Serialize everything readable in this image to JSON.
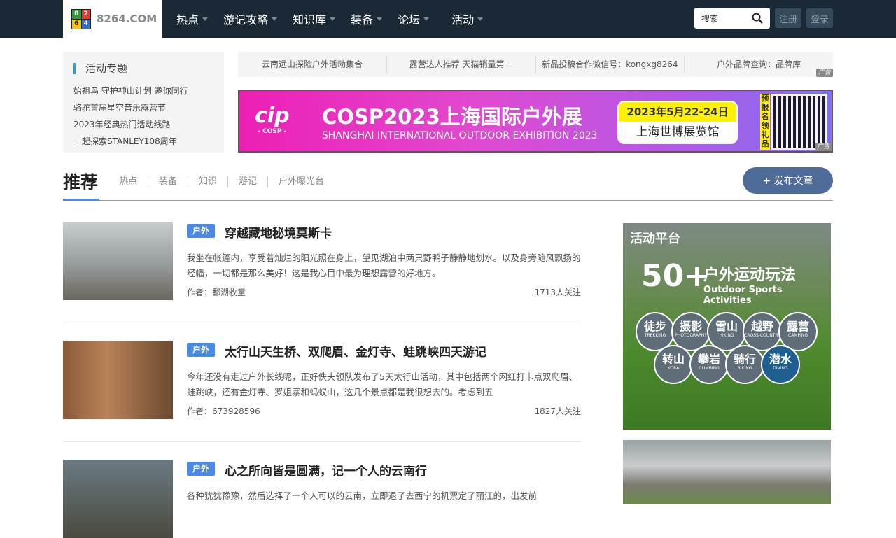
{
  "header": {
    "logo_text": "8264.COM",
    "logo_digits": [
      "8",
      "2",
      "6",
      "4"
    ],
    "nav": [
      "热点",
      "游记攻略",
      "知识库",
      "装备",
      "论坛",
      "活动"
    ],
    "search_placeholder": "搜索",
    "register": "注册",
    "login": "登录"
  },
  "topics": {
    "title": "活动专题",
    "items": [
      "始祖鸟 守护神山计划 邀你同行",
      "骆驼首届星空音乐露营节",
      "2023年经典热门活动线路",
      "一起探索STANLEY108周年"
    ]
  },
  "ad_links": [
    "云南远山探险户外活动集合",
    "露营达人推荐 天猫销量第一",
    "新品投稿合作微信号：kongxg8264",
    "户外品牌查询：品牌库"
  ],
  "ad_label": "广告",
  "banner": {
    "logo": "cip",
    "logo_sub": "- COSP -",
    "title": "COSP2023上海国际户外展",
    "subtitle": "SHANGHAI INTERNATIONAL OUTDOOR EXHIBITION 2023",
    "date": "2023年5月22-24日",
    "venue": "上海世博展览馆",
    "side": "预报名领礼品"
  },
  "feed": {
    "title": "推荐",
    "tabs": [
      "热点",
      "装备",
      "知识",
      "游记",
      "户外曝光台"
    ],
    "publish": "+ 发布文章",
    "articles": [
      {
        "tag": "户外",
        "title": "穿越藏地秘境莫斯卡",
        "desc": "我坐在帐篷内，享受着灿烂的阳光照在身上，望见湖泊中两只野鸭子静静地划水。以及身旁随风飘扬的经幡，一切都是那么美好！这是我心目中最为理想露营的好地方。",
        "author": "作者：鄱湖牧童",
        "fans": "1713人关注"
      },
      {
        "tag": "户外",
        "title": "太行山天生桥、双爬眉、金灯寺、蛙跳峡四天游记",
        "desc": "今年还没有走过户外长线呢，正好佚夫领队发布了5天太行山活动，其中包括两个网红打卡点双爬眉、蛙跳峡，还有金灯寺、罗姐寨和蚂蚁山，这几个景点都是我很想去的。考虑到五",
        "author": "作者：673928596",
        "fans": "1827人关注"
      },
      {
        "tag": "户外",
        "title": "心之所向皆是圆满，记一个人的云南行",
        "desc": "各种犹犹豫豫，然后选择了一个人可以的云南，立即退了去西宁的机票定了丽江的，出发前"
      }
    ]
  },
  "side_ad": {
    "header": "活动平台",
    "big": "50+",
    "title": "户外运动玩法",
    "en": "Outdoor Sports Activities",
    "activities": [
      {
        "cn": "徒步",
        "en": "TREKKING"
      },
      {
        "cn": "摄影",
        "en": "PHOTOGRAPHY"
      },
      {
        "cn": "雪山",
        "en": "HIKING"
      },
      {
        "cn": "越野",
        "en": "CROSS-COUNTRY"
      },
      {
        "cn": "露营",
        "en": "CAMPING"
      },
      {
        "cn": "转山",
        "en": "KORA"
      },
      {
        "cn": "攀岩",
        "en": "CLIMBING"
      },
      {
        "cn": "骑行",
        "en": "BIKING"
      },
      {
        "cn": "潜水",
        "en": "DIVING"
      }
    ]
  }
}
